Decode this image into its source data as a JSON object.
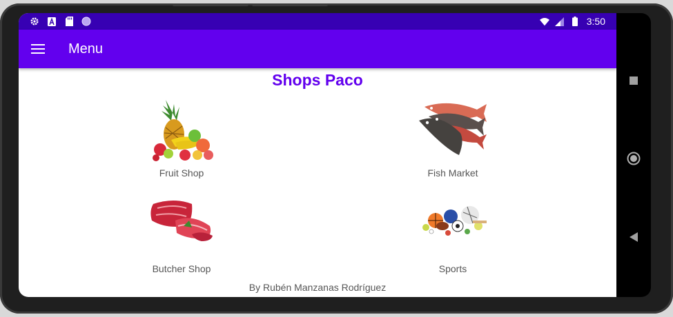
{
  "statusbar": {
    "time": "3:50",
    "left_icons": [
      "settings-icon",
      "font-a-icon",
      "sd-card-icon",
      "circle-notification-icon"
    ],
    "right_icons": [
      "wifi-icon",
      "signal-icon",
      "battery-icon"
    ]
  },
  "appbar": {
    "title": "Menu"
  },
  "page": {
    "title": "Shops Paco"
  },
  "shops": [
    {
      "label": "Fruit Shop",
      "icon": "fruit-image"
    },
    {
      "label": "Fish Market",
      "icon": "fish-image"
    },
    {
      "label": "Butcher Shop",
      "icon": "meat-image"
    },
    {
      "label": "Sports",
      "icon": "sports-balls-image"
    }
  ],
  "footer": {
    "credit": "By Rubén Manzanas Rodríguez"
  },
  "nav": [
    "recents-square-icon",
    "home-circle-icon",
    "back-triangle-icon"
  ],
  "colors": {
    "primary": "#6200ee",
    "primary_dark": "#3700b3",
    "title": "#6200ee"
  }
}
